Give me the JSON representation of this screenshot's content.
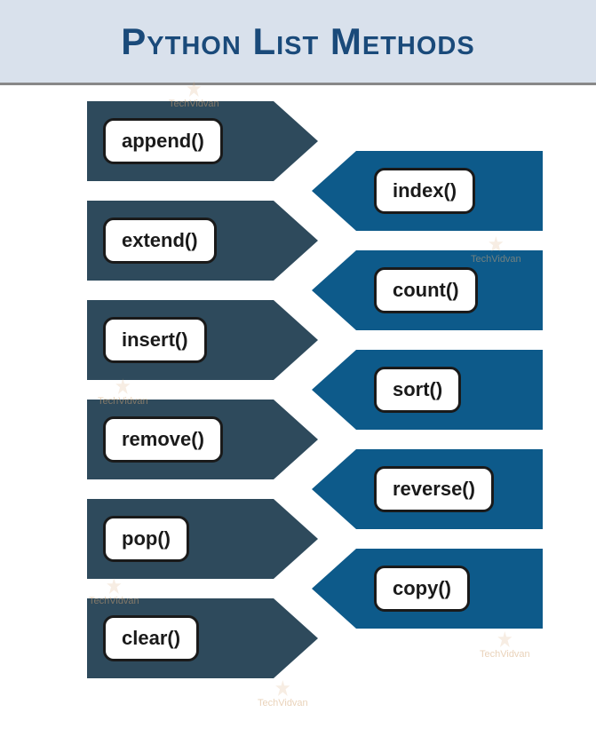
{
  "title": "Python List Methods",
  "left_methods": [
    "append()",
    "extend()",
    "insert()",
    "remove()",
    "pop()",
    "clear()"
  ],
  "right_methods": [
    "index()",
    "count()",
    "sort()",
    "reverse()",
    "copy()"
  ],
  "watermark_text": "TechVidvan",
  "colors": {
    "header_bg": "#d9e1ec",
    "header_text": "#1a4a7a",
    "arrow_dark": "#2e4a5c",
    "arrow_blue": "#0d5a8a"
  }
}
